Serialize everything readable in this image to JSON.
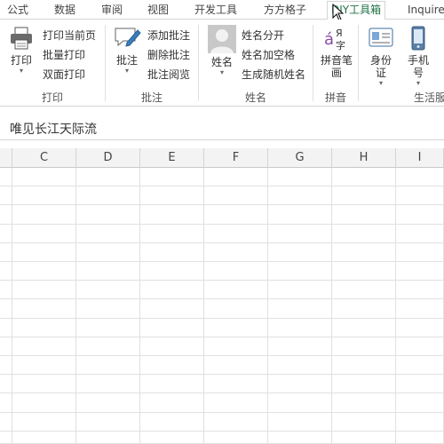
{
  "tabs": [
    {
      "label": "公式"
    },
    {
      "label": "数据"
    },
    {
      "label": "审阅"
    },
    {
      "label": "视图"
    },
    {
      "label": "开发工具"
    },
    {
      "label": "方方格子"
    },
    {
      "label": "DIY工具箱"
    },
    {
      "label": "Inquire"
    }
  ],
  "ribbon": {
    "print_group": {
      "label": "打印",
      "print_button": "打印",
      "print_current_page": "打印当前页",
      "batch_print": "批量打印",
      "duplex_print": "双面打印"
    },
    "comment_group": {
      "label": "批注",
      "comment_button": "批注",
      "add_comment": "添加批注",
      "delete_comment": "删除批注",
      "browse_comment": "批注阅览"
    },
    "name_group": {
      "label": "姓名",
      "name_button": "姓名",
      "split_name": "姓名分开",
      "name_add_space": "姓名加空格",
      "random_name": "生成随机姓名"
    },
    "pinyin_group": {
      "label": "拼音",
      "pinyin_button_line1": "拼音笔",
      "pinyin_button_line2": "画"
    },
    "life_group": {
      "label": "生活服",
      "id_button_line1": "身份",
      "id_button_line2": "证",
      "phone_button_line1": "手机",
      "phone_button_line2": "号"
    }
  },
  "namebar": {
    "text": "唯见长江天际流"
  },
  "columns": [
    "C",
    "D",
    "E",
    "F",
    "G",
    "H",
    "I"
  ],
  "colors": {
    "accent": "#217346",
    "grid_line": "#e1e1e1",
    "header_bg": "#f3f3f3"
  }
}
